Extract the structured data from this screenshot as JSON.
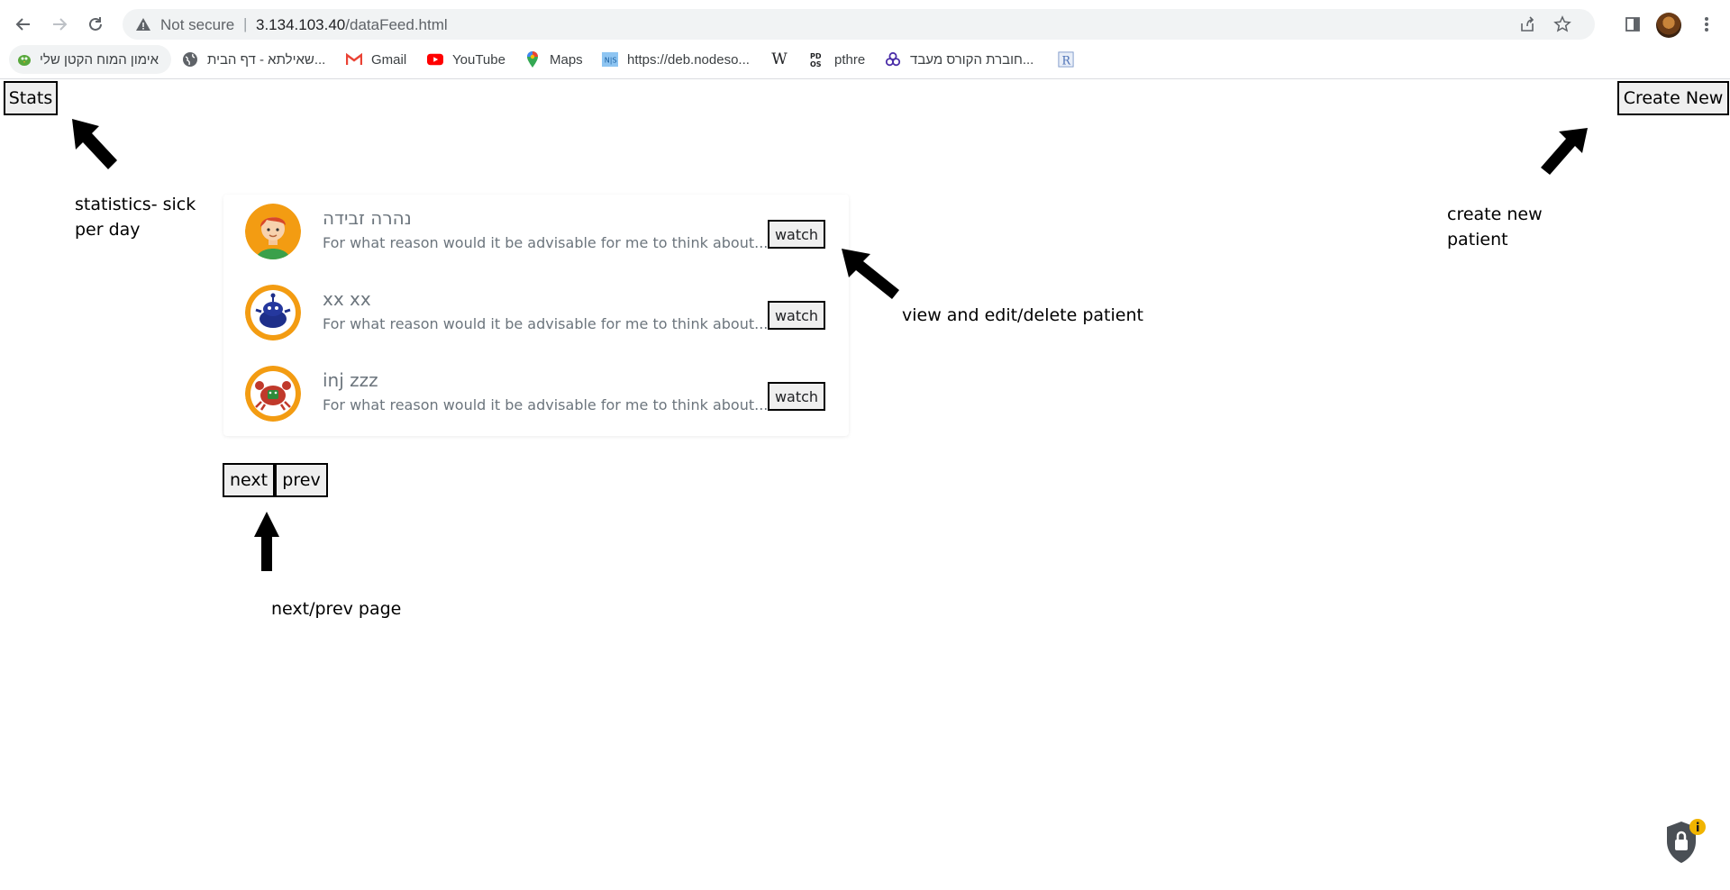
{
  "browser": {
    "omnibox": {
      "security_label": "Not secure",
      "separator": "|",
      "url_host": "3.134.103.40",
      "url_path": "/dataFeed.html"
    },
    "bookmarks": [
      {
        "label": "אימון המוח הקטן שלי",
        "icon": "green-bird-icon"
      },
      {
        "label": "שאילתא - דף הבית...",
        "icon": "globe-icon"
      },
      {
        "label": "Gmail",
        "icon": "gmail-icon"
      },
      {
        "label": "YouTube",
        "icon": "youtube-icon"
      },
      {
        "label": "Maps",
        "icon": "maps-pin-icon"
      },
      {
        "label": "https://deb.nodeso...",
        "icon": "nodesource-icon"
      },
      {
        "label": "",
        "icon": "wikipedia-icon"
      },
      {
        "label": "pthre",
        "icon": "pdos-icon"
      },
      {
        "label": "חוברת הקורס מעבד...",
        "icon": "purple-knot-icon"
      },
      {
        "label": "",
        "icon": "r-doc-icon"
      }
    ]
  },
  "page": {
    "stats_button": "Stats",
    "create_new_button": "Create New",
    "stats_note_line1": "statistics- sick",
    "stats_note_line2": "per day",
    "create_note_line1": "create new",
    "create_note_line2": "patient",
    "watch_note": "view and edit/delete patient",
    "pager_note": "next/prev page",
    "next_button": "next",
    "prev_button": "prev"
  },
  "feed": {
    "items": [
      {
        "name": "נהרה זבידה",
        "description": "For what reason would it be advisable for me to think about...",
        "watch_label": "watch",
        "avatar": "boy-avatar-icon"
      },
      {
        "name": "xx xx",
        "description": "For what reason would it be advisable for me to think about...",
        "watch_label": "watch",
        "avatar": "blue-creature-avatar-icon"
      },
      {
        "name": "inj zzz",
        "description": "For what reason would it be advisable for me to think about...",
        "watch_label": "watch",
        "avatar": "crab-avatar-icon"
      }
    ]
  },
  "colors": {
    "accent_orange": "#f39c12",
    "muted_text": "#6c757d"
  }
}
